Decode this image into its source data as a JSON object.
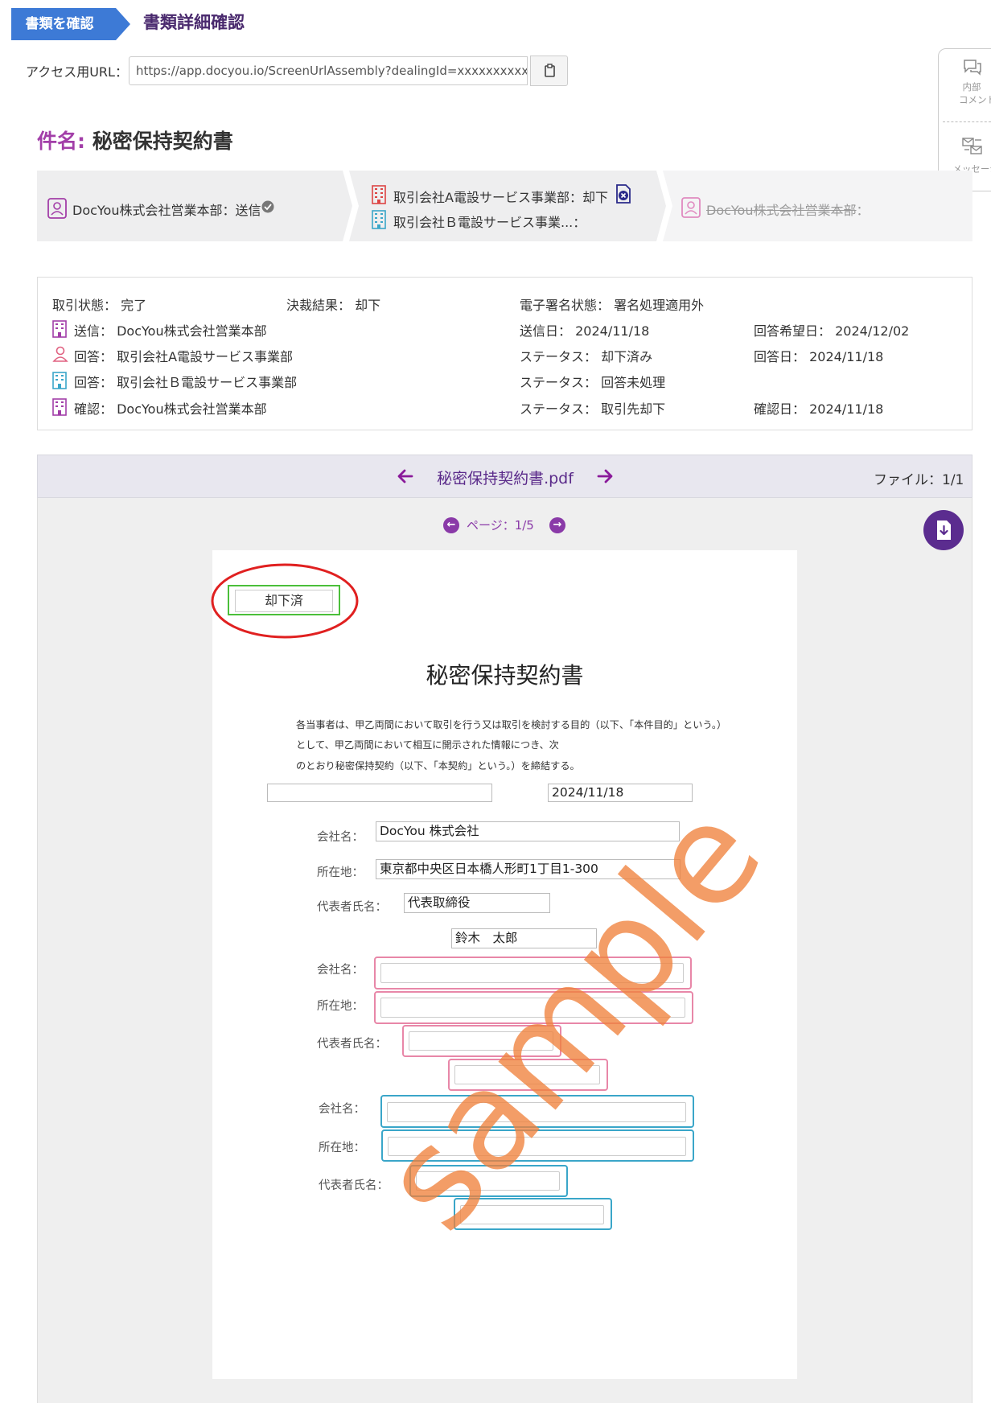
{
  "header": {
    "breadcrumb_label": "書類を確認",
    "page_title": "書類詳細確認"
  },
  "access_url": {
    "label": "アクセス用URL：",
    "value": "https://app.docyou.io/ScreenUrlAssembly?dealingId=xxxxxxxxxxxx...",
    "copy_icon": "clipboard-icon"
  },
  "side_panel": {
    "comment_label_1": "内部",
    "comment_label_2": "コメント",
    "message_label": "メッセージ"
  },
  "subject": {
    "key": "件名:",
    "value": "秘密保持契約書"
  },
  "flow": {
    "step1": {
      "text": "DocYou株式会社営業本部：送信",
      "icon": "person-icon"
    },
    "step2a": {
      "text": "取引会社A電設サービス事業部：却下",
      "icon": "building-icon"
    },
    "step2b": {
      "text": "取引会社Ｂ電設サービス事業...：",
      "icon": "building-icon"
    },
    "step3": {
      "text": "DocYou株式会社営業本部",
      "suffix": "：",
      "icon": "person-icon"
    }
  },
  "info": {
    "deal_state_label": "取引状態：",
    "deal_state": "完了",
    "decision_label": "決裁結果：",
    "decision": "却下",
    "esign_label": "電子署名状態：",
    "esign": "署名処理適用外",
    "rows": [
      {
        "role": "送信：",
        "party": "DocYou株式会社営業本部",
        "mid_label": "送信日：",
        "mid_value": "2024/11/18",
        "right_label": "回答希望日：",
        "right_value": "2024/12/02"
      },
      {
        "role": "回答：",
        "party": "取引会社A電設サービス事業部",
        "mid_label": "ステータス：",
        "mid_value": "却下済み",
        "right_label": "回答日：",
        "right_value": "2024/11/18"
      },
      {
        "role": "回答：",
        "party": "取引会社Ｂ電設サービス事業部",
        "mid_label": "ステータス：",
        "mid_value": "回答未処理",
        "right_label": "",
        "right_value": ""
      },
      {
        "role": "確認：",
        "party": "DocYou株式会社営業本部",
        "mid_label": "ステータス：",
        "mid_value": "取引先却下",
        "right_label": "確認日：",
        "right_value": "2024/11/18"
      }
    ]
  },
  "viewer": {
    "file_name": "秘密保持契約書.pdf",
    "file_count": "ファイル：1/1",
    "page_indicator": "ページ：1/5"
  },
  "document": {
    "stamp": "却下済",
    "title": "秘密保持契約書",
    "para1": "各当事者は、甲乙両間において取引を行う又は取引を検討する目的（以下、「本件目的」という。）",
    "para2": "として、甲乙両間において相互に開示された情報につき、次",
    "para3": "のとおり秘密保持契約（以下、「本契約」という。）を締結する。",
    "date_value": "2024/11/18",
    "company_label": "会社名：",
    "address_label": "所在地：",
    "rep_label": "代表者氏名：",
    "company_value": "DocYou 株式会社",
    "address_value": "東京都中央区日本橋人形町1丁目1-300",
    "rep_title_value": "代表取締役",
    "rep_name_value": "鈴木　太郎",
    "watermark": "sample"
  }
}
